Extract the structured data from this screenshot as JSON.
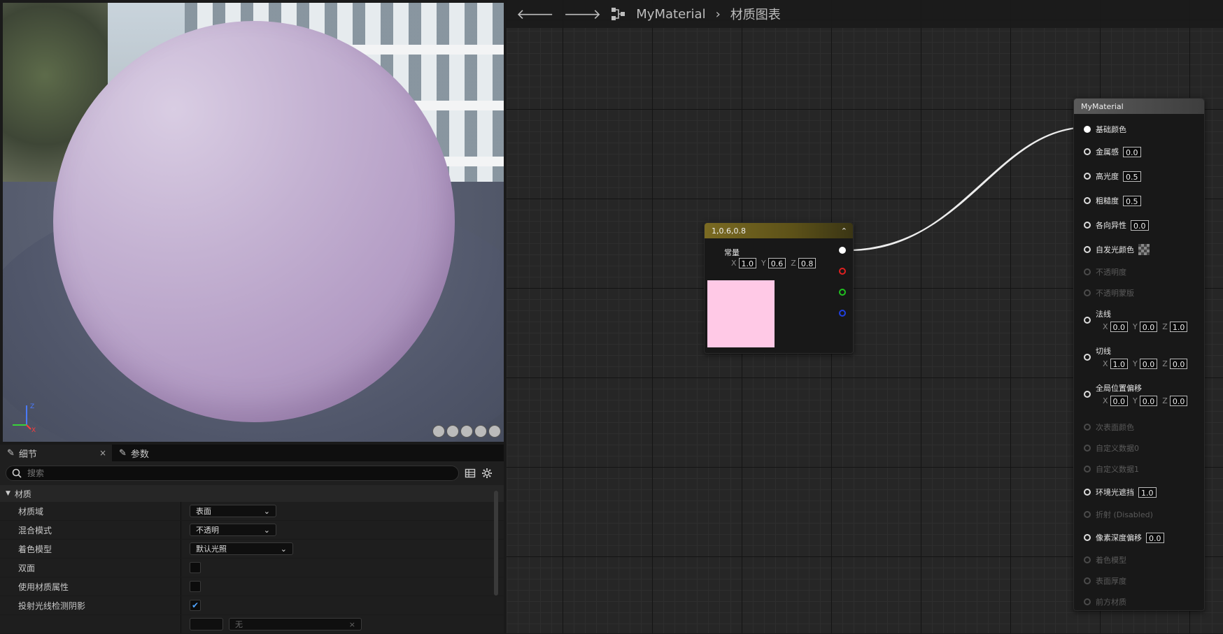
{
  "graph": {
    "breadcrumb_root": "MyMaterial",
    "breadcrumb_current": "材质图表",
    "constant_node": {
      "title": "1,0.6,0.8",
      "label": "常量",
      "x": "1.0",
      "y": "0.6",
      "z": "0.8",
      "swatch_color": "#ffc9e6",
      "pin_colors": [
        "#ffffff",
        "#e02020",
        "#20c020",
        "#2040e0"
      ]
    },
    "material_node": {
      "title": "MyMaterial",
      "inputs": [
        {
          "label": "基础颜色",
          "active": true
        },
        {
          "label": "金属感",
          "value": "0.0",
          "active": true
        },
        {
          "label": "高光度",
          "value": "0.5",
          "active": true
        },
        {
          "label": "粗糙度",
          "value": "0.5",
          "active": true
        },
        {
          "label": "各向异性",
          "value": "0.0",
          "active": true
        },
        {
          "label": "自发光颜色",
          "active": true
        },
        {
          "label": "不透明度",
          "active": false
        },
        {
          "label": "不透明蒙版",
          "active": false
        },
        {
          "label": "法线",
          "x": "0.0",
          "y": "0.0",
          "z": "1.0",
          "active": true
        },
        {
          "label": "切线",
          "x": "1.0",
          "y": "0.0",
          "z": "0.0",
          "active": true
        },
        {
          "label": "全局位置偏移",
          "x": "0.0",
          "y": "0.0",
          "z": "0.0",
          "active": true
        },
        {
          "label": "次表面颜色",
          "active": false
        },
        {
          "label": "自定义数据0",
          "active": false
        },
        {
          "label": "自定义数据1",
          "active": false
        },
        {
          "label": "环境光遮挡",
          "value": "1.0",
          "active": true
        },
        {
          "label": "折射 (Disabled)",
          "active": false
        },
        {
          "label": "像素深度偏移",
          "value": "0.0",
          "active": true
        },
        {
          "label": "着色模型",
          "active": false
        },
        {
          "label": "表面厚度",
          "active": false
        },
        {
          "label": "前方材质",
          "active": false
        }
      ]
    }
  },
  "details": {
    "tab_details": "细节",
    "tab_params": "参数",
    "close_glyph": "×",
    "search_placeholder": "搜索",
    "section": "材质",
    "material_domain": {
      "label": "材质域",
      "value": "表面"
    },
    "blend_mode": {
      "label": "混合模式",
      "value": "不透明"
    },
    "shading_model": {
      "label": "着色模型",
      "value": "默认光照"
    },
    "two_sided": {
      "label": "双面",
      "checked": false
    },
    "use_material_attributes": {
      "label": "使用材质属性",
      "checked": false
    },
    "cast_ray_traced_shadows": {
      "label": "投射光线检测阴影",
      "checked": true
    },
    "last_row_value": "无"
  },
  "viewport": {
    "axis_z": "Z",
    "axis_x": "X",
    "sphere_color": "#c4b2d2"
  },
  "icons": {
    "back": "back-arrow-icon",
    "forward": "forward-arrow-icon",
    "hierarchy": "hierarchy-icon",
    "search": "search-icon",
    "grid": "grid-view-icon",
    "settings": "gear-icon"
  }
}
